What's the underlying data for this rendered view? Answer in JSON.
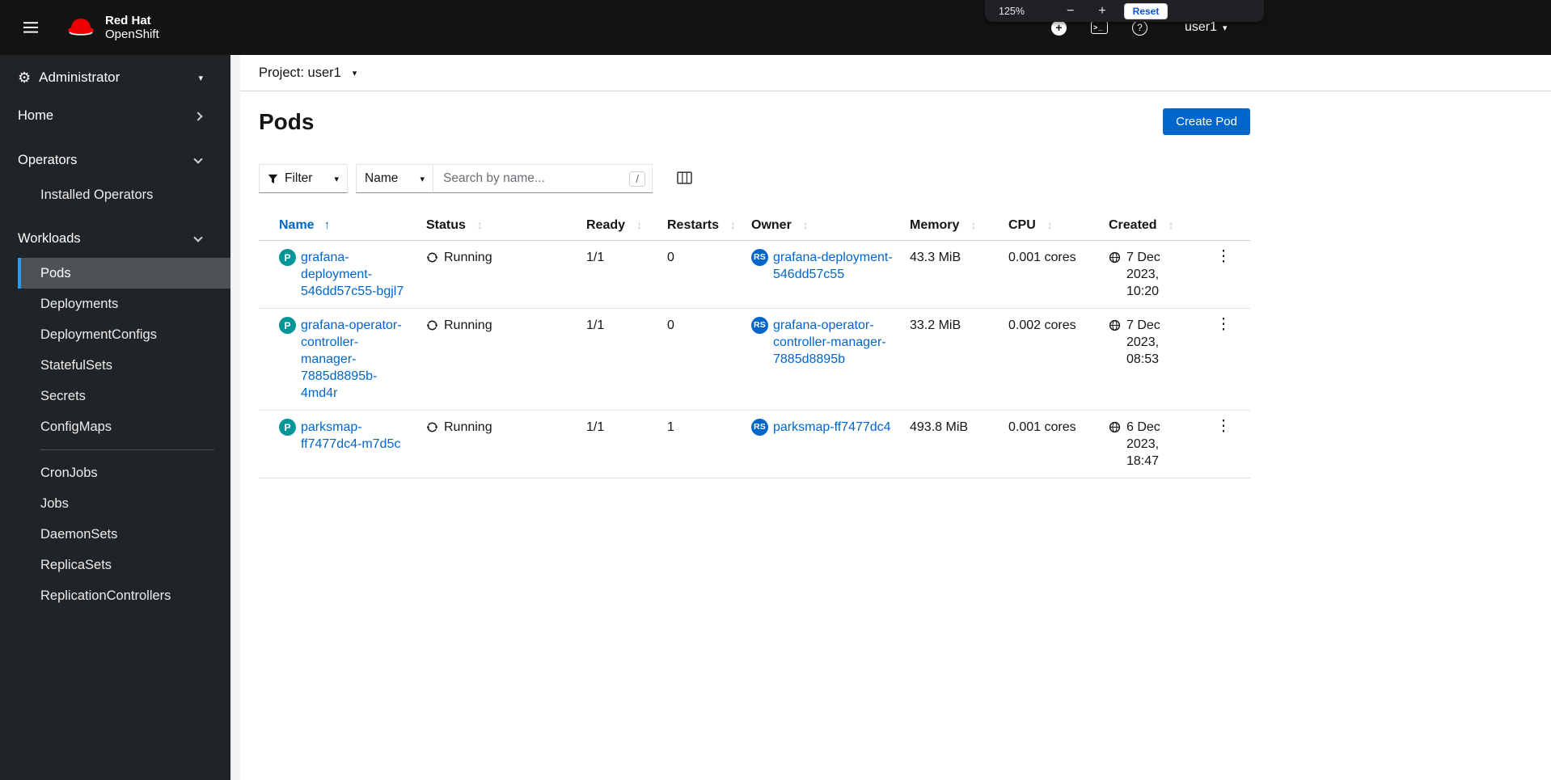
{
  "masthead": {
    "brand": {
      "line1": "Red Hat",
      "line2": "OpenShift"
    },
    "user": "user1"
  },
  "zoom_popup": {
    "level": "125%",
    "minus": "−",
    "plus": "+",
    "reset": "Reset"
  },
  "sidebar": {
    "perspective": "Administrator",
    "nav": {
      "home": "Home",
      "operators": "Operators",
      "operators_items": [
        "Installed Operators"
      ],
      "workloads": "Workloads",
      "workloads_items_a": [
        "Pods",
        "Deployments",
        "DeploymentConfigs",
        "StatefulSets",
        "Secrets",
        "ConfigMaps"
      ],
      "workloads_items_b": [
        "CronJobs",
        "Jobs",
        "DaemonSets",
        "ReplicaSets",
        "ReplicationControllers"
      ],
      "active_item": "Pods"
    }
  },
  "project_bar": {
    "label": "Project: user1"
  },
  "page": {
    "title": "Pods",
    "create_button": "Create Pod"
  },
  "toolbar": {
    "filter": "Filter",
    "name_selector": "Name",
    "search_placeholder": "Search by name...",
    "shortcut": "/"
  },
  "table": {
    "columns": [
      "Name",
      "Status",
      "Ready",
      "Restarts",
      "Owner",
      "Memory",
      "CPU",
      "Created"
    ],
    "sort": {
      "column": "Name",
      "direction": "asc"
    },
    "rows": [
      {
        "badge": "P",
        "name": "grafana-deployment-546dd57c55-bgjl7",
        "status": "Running",
        "ready": "1/1",
        "restarts": "0",
        "owner_badge": "RS",
        "owner": "grafana-deployment-546dd57c55",
        "memory": "43.3 MiB",
        "cpu": "0.001 cores",
        "created": "7 Dec 2023, 10:20"
      },
      {
        "badge": "P",
        "name": "grafana-operator-controller-manager-7885d8895b-4md4r",
        "status": "Running",
        "ready": "1/1",
        "restarts": "0",
        "owner_badge": "RS",
        "owner": "grafana-operator-controller-manager-7885d8895b",
        "memory": "33.2 MiB",
        "cpu": "0.002 cores",
        "created": "7 Dec 2023, 08:53"
      },
      {
        "badge": "P",
        "name": "parksmap-ff7477dc4-m7d5c",
        "status": "Running",
        "ready": "1/1",
        "restarts": "1",
        "owner_badge": "RS",
        "owner": "parksmap-ff7477dc4",
        "memory": "493.8 MiB",
        "cpu": "0.001 cores",
        "created": "6 Dec 2023, 18:47"
      }
    ]
  }
}
